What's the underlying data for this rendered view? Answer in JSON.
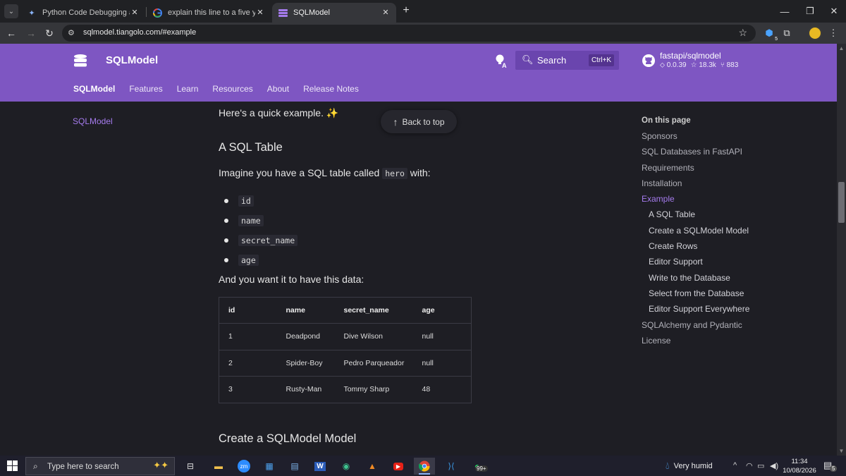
{
  "browser": {
    "tabs": [
      {
        "title": "Python Code Debugging and Tr",
        "favicon": "gemini-icon",
        "active": false
      },
      {
        "title": "explain this line to a five year ol",
        "favicon": "google-icon",
        "active": false
      },
      {
        "title": "SQLModel",
        "favicon": "sqlmodel-icon",
        "active": true
      }
    ],
    "url": "sqlmodel.tiangolo.com/#example"
  },
  "header": {
    "site_name": "SQLModel",
    "search_label": "Search",
    "search_shortcut": "Ctrl+K",
    "repo": {
      "name": "fastapi/sqlmodel",
      "version": "0.0.39",
      "stars": "18.3k",
      "forks": "883"
    },
    "nav_tabs": [
      "SQLModel",
      "Features",
      "Learn",
      "Resources",
      "About",
      "Release Notes"
    ]
  },
  "left_nav": {
    "item": "SQLModel"
  },
  "content": {
    "intro": "Here's a quick example. ✨",
    "back_to_top": "Back to top",
    "h2_table": "A SQL Table",
    "para_imagine_before": "Imagine you have a SQL table called ",
    "para_imagine_code": "hero",
    "para_imagine_after": " with:",
    "fields": [
      "id",
      "name",
      "secret_name",
      "age"
    ],
    "para_data": "And you want it to have this data:",
    "table": {
      "headers": [
        "id",
        "name",
        "secret_name",
        "age"
      ],
      "rows": [
        [
          "1",
          "Deadpond",
          "Dive Wilson",
          "null"
        ],
        [
          "2",
          "Spider-Boy",
          "Pedro Parqueador",
          "null"
        ],
        [
          "3",
          "Rusty-Man",
          "Tommy Sharp",
          "48"
        ]
      ]
    },
    "h2_model": "Create a SQLModel Model"
  },
  "toc": {
    "title": "On this page",
    "items": [
      {
        "label": "Sponsors",
        "level": 1
      },
      {
        "label": "SQL Databases in FastAPI",
        "level": 1
      },
      {
        "label": "Requirements",
        "level": 1
      },
      {
        "label": "Installation",
        "level": 1
      },
      {
        "label": "Example",
        "level": 1,
        "active": true
      },
      {
        "label": "A SQL Table",
        "level": 2
      },
      {
        "label": "Create a SQLModel Model",
        "level": 2
      },
      {
        "label": "Create Rows",
        "level": 2
      },
      {
        "label": "Editor Support",
        "level": 2
      },
      {
        "label": "Write to the Database",
        "level": 2
      },
      {
        "label": "Select from the Database",
        "level": 2
      },
      {
        "label": "Editor Support Everywhere",
        "level": 2
      },
      {
        "label": "SQLAlchemy and Pydantic",
        "level": 1
      },
      {
        "label": "License",
        "level": 1
      }
    ]
  },
  "taskbar": {
    "search_placeholder": "Type here to search",
    "weather": "Very humid",
    "time": "11:34",
    "date": "10/08/2026",
    "whatsapp_badge": "99+",
    "notification_count": "5"
  },
  "colors": {
    "accent": "#7e56c2",
    "link": "#a57bed",
    "page_bg": "#1e1e24"
  }
}
